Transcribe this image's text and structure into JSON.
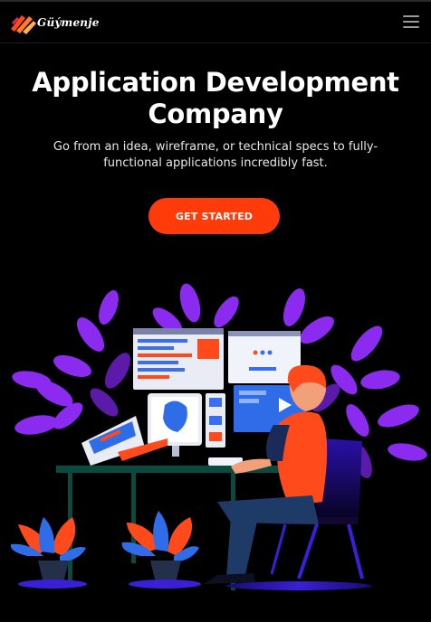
{
  "header": {
    "logo_text": "Güýmenje",
    "logo_icon": "brush-stroke-logo",
    "menu_icon": "hamburger-menu-icon"
  },
  "hero": {
    "title": "Application Development Company",
    "subtitle": "Go from an idea, wireframe, or technical specs to fully-functional applications incredibly fast.",
    "cta_label": "GET STARTED"
  },
  "colors": {
    "background": "#000000",
    "accent": "#ff3b0a",
    "leaf": "#8a2be2",
    "leaf_light": "#a855f7"
  }
}
